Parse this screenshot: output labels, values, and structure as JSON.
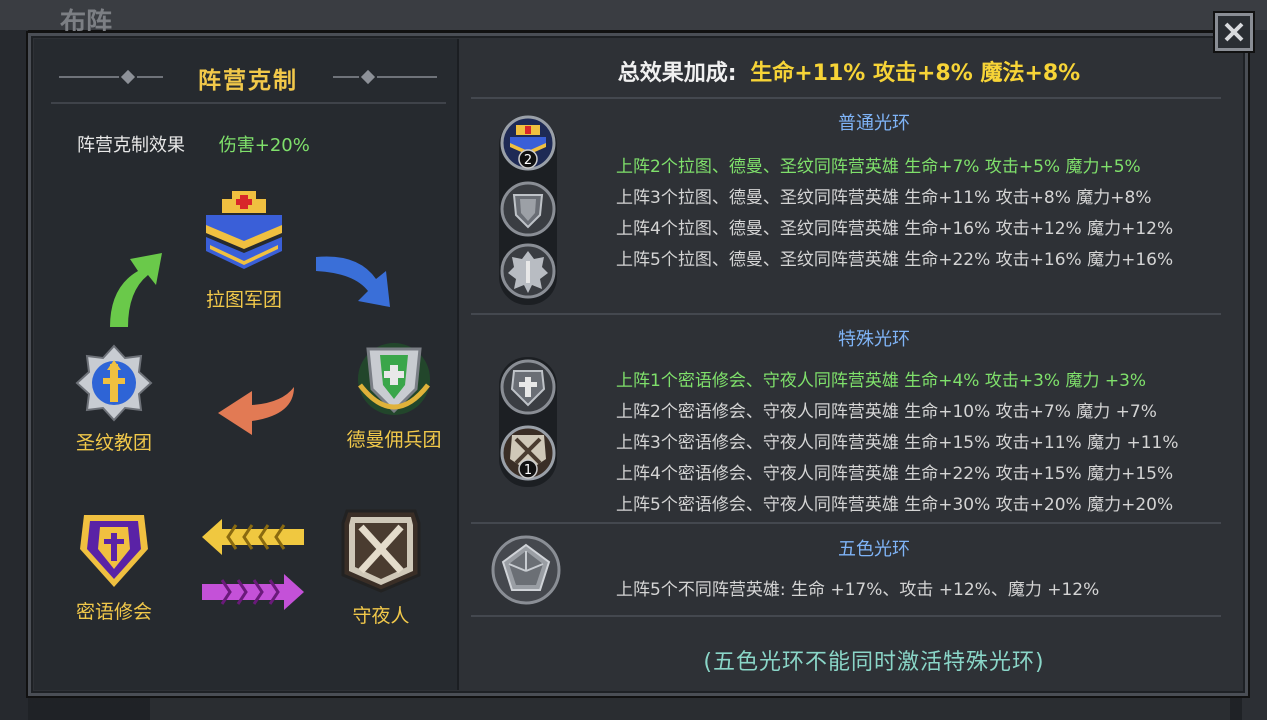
{
  "background": {
    "window_title": "布阵"
  },
  "left": {
    "title": "阵营克制",
    "counter_label": "阵营克制效果",
    "counter_value": "伤害+20%",
    "factions": {
      "latu": "拉图军团",
      "deyuan": "德曼佣兵团",
      "shengwen": "圣纹教团",
      "miyu": "密语修会",
      "shouye": "守夜人"
    }
  },
  "right": {
    "total_label": "总效果加成:",
    "total_value": "生命+11% 攻击+8% 魔法+8%",
    "normal_aura": {
      "title": "普通光环",
      "icon_badges": [
        "2"
      ],
      "lines": [
        "上阵2个拉图、德曼、圣纹同阵营英雄 生命+7% 攻击+5% 魔力+5%",
        "上阵3个拉图、德曼、圣纹同阵营英雄 生命+11% 攻击+8% 魔力+8%",
        "上阵4个拉图、德曼、圣纹同阵营英雄 生命+16% 攻击+12% 魔力+12%",
        "上阵5个拉图、德曼、圣纹同阵营英雄 生命+22% 攻击+16% 魔力+16%"
      ],
      "active_index": 0
    },
    "special_aura": {
      "title": "特殊光环",
      "icon_badges": [
        "1"
      ],
      "lines": [
        "上阵1个密语修会、守夜人同阵营英雄 生命+4% 攻击+3% 魔力 +3%",
        "上阵2个密语修会、守夜人同阵营英雄 生命+10% 攻击+7% 魔力 +7%",
        "上阵3个密语修会、守夜人同阵营英雄 生命+15% 攻击+11% 魔力 +11%",
        "上阵4个密语修会、守夜人同阵营英雄 生命+22% 攻击+15% 魔力+15%",
        "上阵5个密语修会、守夜人同阵营英雄 生命+30% 攻击+20% 魔力+20%"
      ],
      "active_index": 0
    },
    "five_color_aura": {
      "title": "五色光环",
      "line": "上阵5个不同阵营英雄: 生命 +17%、攻击 +12%、魔力 +12%"
    },
    "footer_note": "(五色光环不能同时激活特殊光环)"
  },
  "colors": {
    "gold": "#f1c84a",
    "active_green": "#7fe06b",
    "section_blue": "#7fb4f7",
    "footer_teal": "#8ad6c8",
    "total_yellow": "#f7d437"
  },
  "icons": {
    "close": "close-icon",
    "latu": "latu-legion-emblem-icon",
    "deyuan": "deyuan-mercenary-emblem-icon",
    "shengwen": "shengwen-order-emblem-icon",
    "miyu": "miyu-order-emblem-icon",
    "shouye": "night-watch-emblem-icon"
  }
}
